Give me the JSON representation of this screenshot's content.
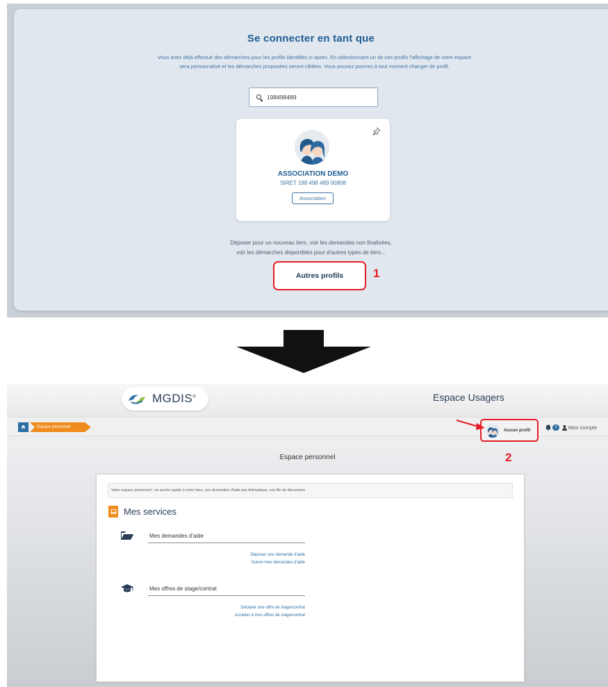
{
  "login": {
    "title": "Se connecter en tant que",
    "intro_line1": "Vous avez déjà effectué des démarches pour les profils identifiés ci-après. En sélectionnant un de ces profils l'affichage de votre espace",
    "intro_line2": "sera personnalisé et les démarches proposées seront ciblées. Vous pouvez pourrez à tout moment changer de profil.",
    "search_value": "198498489",
    "card": {
      "name": "ASSOCIATION DEMO",
      "siret": "SIRET 198 498 489 00808",
      "badge": "Association"
    },
    "other_text_line1": "Déposer pour un nouveau tiers, voir les demandes non finalisées,",
    "other_text_line2": "voir les démarches disponibles pour d'autres types de tiers...",
    "other_button": "Autres profils",
    "marker": "1"
  },
  "portal": {
    "logo_text": "MGDIS",
    "logo_mark": "®",
    "app_title": "Espace Usagers",
    "breadcrumb": "Espace personnel",
    "profile_label": "Aucun profil",
    "notification_count": "0",
    "account_label": "Mon compte",
    "marker": "2",
    "page_heading": "Espace personnel",
    "intro": "Votre espace personnel : un accès rapide à votre tiers, vos demandes d'aide par thématique, vos fils de discussion",
    "services_title": "Mes services",
    "services": [
      {
        "label": "Mes demandes d'aide",
        "links": [
          "Déposer une demande d'aide",
          "Suivre mes demandes d'aide"
        ]
      },
      {
        "label": "Mes offres de stage/contrat",
        "links": [
          "Déclarer une offre de stage/contrat",
          "Accéder à mes offres de stage/contrat"
        ]
      }
    ]
  },
  "colors": {
    "highlight": "#e51b24",
    "brand_blue": "#1e5d94",
    "accent_orange": "#f08c1e"
  }
}
